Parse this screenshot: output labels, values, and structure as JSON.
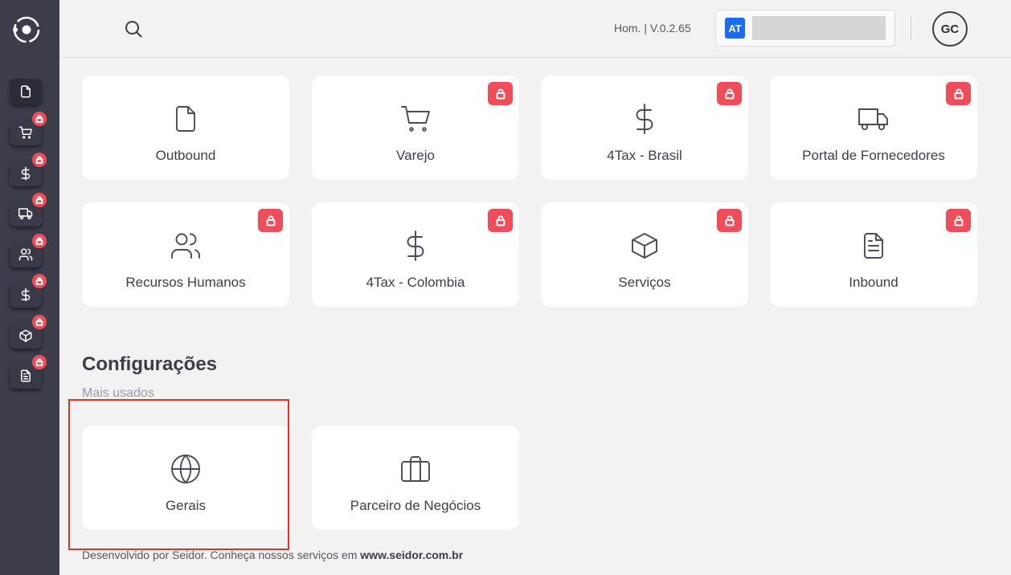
{
  "header": {
    "version": "Hom. | V.0.2.65",
    "company_badge": "AT",
    "company_name": "",
    "avatar_initials": "GC"
  },
  "sidebar": {
    "items": [
      {
        "icon": "file-icon",
        "locked": false,
        "active": true
      },
      {
        "icon": "cart-icon",
        "locked": true
      },
      {
        "icon": "dollar-icon",
        "locked": true
      },
      {
        "icon": "truck-icon",
        "locked": true
      },
      {
        "icon": "users-icon",
        "locked": true
      },
      {
        "icon": "dollar-icon",
        "locked": true
      },
      {
        "icon": "box-icon",
        "locked": true
      },
      {
        "icon": "document-icon",
        "locked": true
      }
    ]
  },
  "modules": [
    {
      "label": "Outbound",
      "icon": "file-icon",
      "locked": false
    },
    {
      "label": "Varejo",
      "icon": "cart-icon",
      "locked": true
    },
    {
      "label": "4Tax - Brasil",
      "icon": "dollar-icon",
      "locked": true
    },
    {
      "label": "Portal de Fornecedores",
      "icon": "truck-icon",
      "locked": true
    },
    {
      "label": "Recursos Humanos",
      "icon": "users-icon",
      "locked": true
    },
    {
      "label": "4Tax - Colombia",
      "icon": "dollar-icon",
      "locked": true
    },
    {
      "label": "Serviços",
      "icon": "box-icon",
      "locked": true
    },
    {
      "label": "Inbound",
      "icon": "document-icon",
      "locked": true
    }
  ],
  "settings": {
    "title": "Configurações",
    "subtitle": "Mais usados",
    "items": [
      {
        "label": "Gerais",
        "icon": "globe-icon",
        "highlighted": true
      },
      {
        "label": "Parceiro de Negócios",
        "icon": "briefcase-icon"
      }
    ]
  },
  "footer": {
    "text": "Desenvolvido por Seidor. Conheça nossos serviços em ",
    "link": "www.seidor.com.br"
  },
  "colors": {
    "sidebar_bg": "#3d3c4b",
    "lock_red": "#ef4d5a",
    "badge_blue": "#1a6cf0",
    "highlight": "#e0321e",
    "page_bg": "#f2f2f2"
  }
}
